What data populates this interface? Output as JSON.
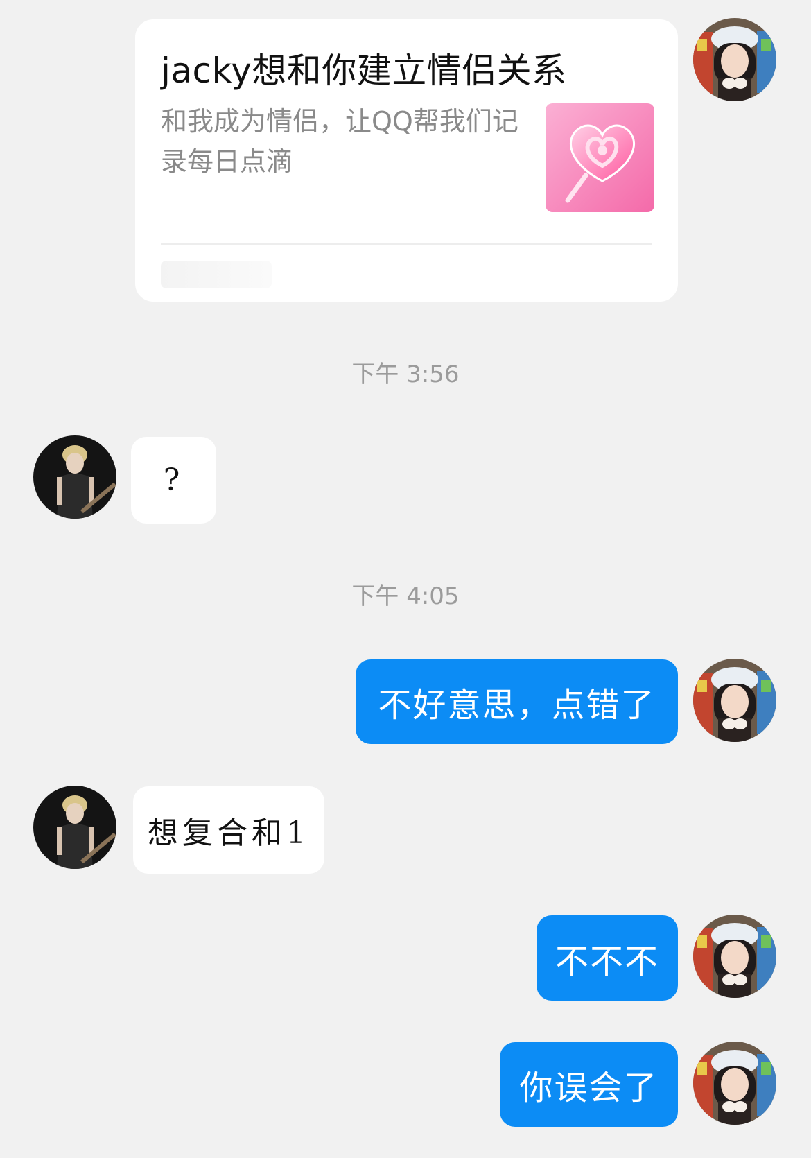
{
  "invitation_card": {
    "title": "jacky想和你建立情侣关系",
    "description": "和我成为情侣，让QQ帮我们记录每日点滴",
    "thumbnail_icon": "lollipop-heart-icon",
    "thumbnail_color": "#f77fb7"
  },
  "messages": [
    {
      "type": "time",
      "text": "下午 3:56"
    },
    {
      "type": "incoming",
      "text": "?"
    },
    {
      "type": "time",
      "text": "下午 4:05"
    },
    {
      "type": "outgoing",
      "text": "不好意思，点错了"
    },
    {
      "type": "incoming",
      "text": "想复合和1"
    },
    {
      "type": "outgoing",
      "text": "不不不"
    },
    {
      "type": "outgoing",
      "text": "你误会了"
    }
  ],
  "colors": {
    "background": "#f1f1f1",
    "outgoing_bubble": "#0c8cf5",
    "incoming_bubble": "#ffffff",
    "timestamp": "#9b9b9b"
  }
}
